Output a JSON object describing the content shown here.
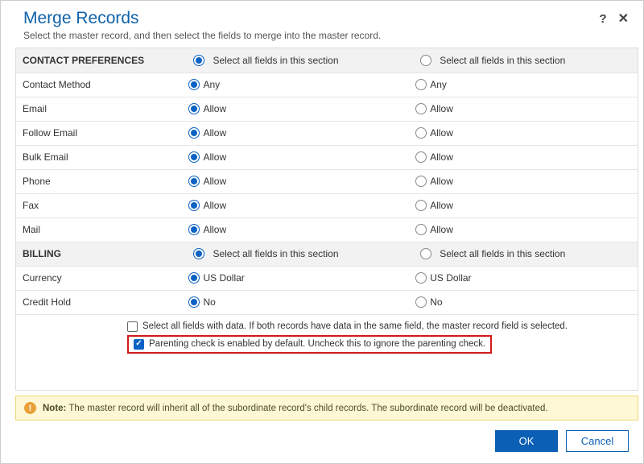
{
  "header": {
    "title": "Merge Records",
    "subtitle": "Select the master record, and then select the fields to merge into the master record."
  },
  "select_section_label": "Select all fields in this section",
  "sections": [
    {
      "title": "CONTACT PREFERENCES",
      "rows": [
        {
          "label": "Contact Method",
          "master": "Any",
          "sub": "Any",
          "sel": "master"
        },
        {
          "label": "Email",
          "master": "Allow",
          "sub": "Allow",
          "sel": "master"
        },
        {
          "label": "Follow Email",
          "master": "Allow",
          "sub": "Allow",
          "sel": "master"
        },
        {
          "label": "Bulk Email",
          "master": "Allow",
          "sub": "Allow",
          "sel": "master"
        },
        {
          "label": "Phone",
          "master": "Allow",
          "sub": "Allow",
          "sel": "master"
        },
        {
          "label": "Fax",
          "master": "Allow",
          "sub": "Allow",
          "sel": "master"
        },
        {
          "label": "Mail",
          "master": "Allow",
          "sub": "Allow",
          "sel": "master"
        }
      ]
    },
    {
      "title": "BILLING",
      "rows": [
        {
          "label": "Currency",
          "master": "US Dollar",
          "sub": "US Dollar",
          "sel": "master"
        },
        {
          "label": "Credit Hold",
          "master": "No",
          "sub": "No",
          "sel": "master"
        }
      ]
    }
  ],
  "options": {
    "select_all_data": {
      "checked": false,
      "label": "Select all fields with data. If both records have data in the same field, the master record field is selected."
    },
    "parenting_check": {
      "checked": true,
      "label": "Parenting check is enabled by default. Uncheck this to ignore the parenting check."
    }
  },
  "note": {
    "prefix": "Note:",
    "text": "The master record will inherit all of the subordinate record's child records. The subordinate record will be deactivated."
  },
  "footer": {
    "ok": "OK",
    "cancel": "Cancel"
  }
}
